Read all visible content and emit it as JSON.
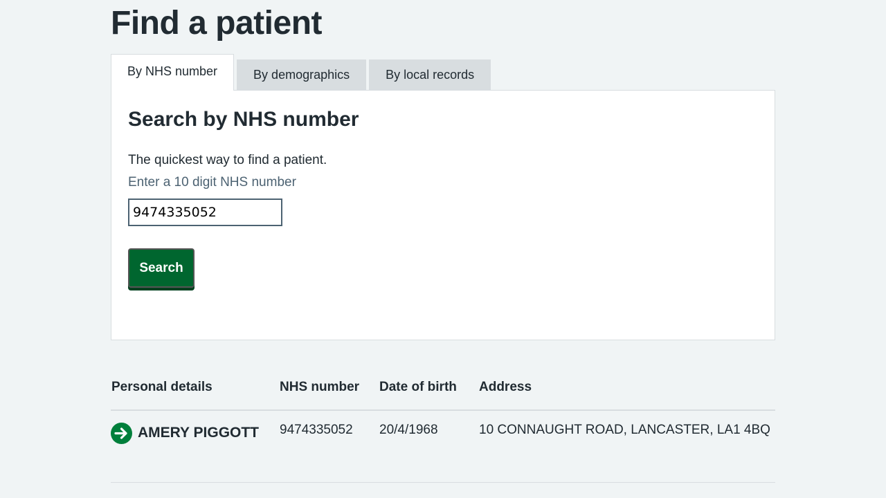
{
  "page": {
    "title": "Find a patient"
  },
  "tabs": [
    {
      "label": "By NHS number",
      "active": true
    },
    {
      "label": "By demographics",
      "active": false
    },
    {
      "label": "By local records",
      "active": false
    }
  ],
  "search_panel": {
    "heading": "Search by NHS number",
    "description": "The quickest way to find a patient.",
    "hint": "Enter a 10 digit NHS number",
    "nhs_value": "9474335052",
    "button_label": "Search"
  },
  "results": {
    "columns": [
      "Personal details",
      "NHS number",
      "Date of birth",
      "Address"
    ],
    "rows": [
      {
        "name": "AMERY PIGGOTT",
        "nhs_number": "9474335052",
        "dob": "20/4/1968",
        "address": "10 CONNAUGHT ROAD, LANCASTER, LA1 4BQ",
        "icon": "arrow-right-circle-icon"
      }
    ]
  },
  "colors": {
    "background": "#f0f4f5",
    "primary_green": "#007f3b",
    "text": "#212b32",
    "hint": "#4c6272"
  }
}
